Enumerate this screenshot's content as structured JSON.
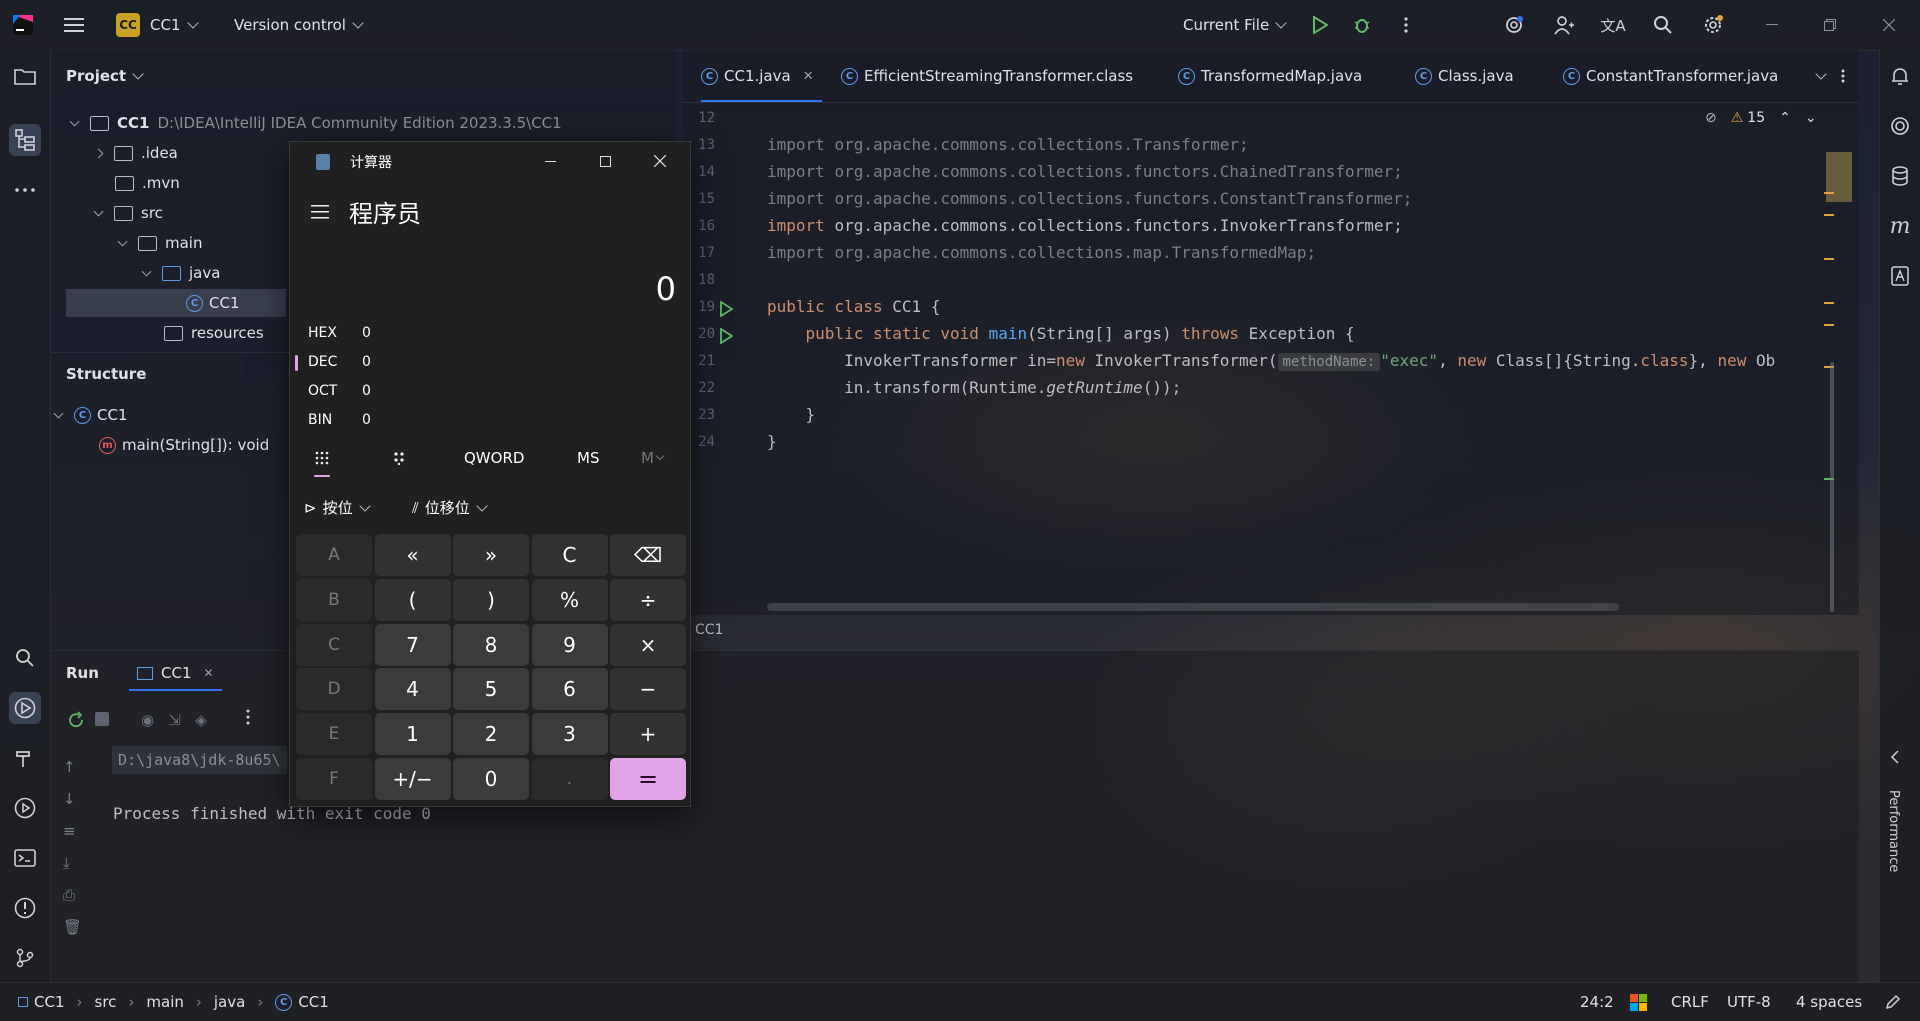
{
  "titlebar": {
    "project_badge": "CC",
    "project_name": "CC1",
    "vcs": "Version control",
    "run_config": "Current File"
  },
  "project": {
    "header": "Project",
    "root_name": "CC1",
    "root_path": "D:\\IDEA\\IntelliJ IDEA Community Edition 2023.3.5\\CC1",
    "items": [
      ".idea",
      ".mvn",
      "src",
      "main",
      "java",
      "CC1",
      "resources"
    ]
  },
  "structure": {
    "header": "Structure",
    "class_name": "CC1",
    "method": "main(String[]): void"
  },
  "editor": {
    "tabs": [
      "CC1.java",
      "EfficientStreamingTransformer.class",
      "TransformedMap.java",
      "Class.java",
      "ConstantTransformer.java"
    ],
    "warnings_count": "15",
    "line_numbers": [
      "12",
      "13",
      "14",
      "15",
      "16",
      "17",
      "18",
      "19",
      "20",
      "21",
      "22",
      "23",
      "24"
    ],
    "imports": [
      "org.apache.commons.collections.Transformer;",
      "org.apache.commons.collections.functors.ChainedTransformer;",
      "org.apache.commons.collections.functors.ConstantTransformer;",
      "org.apache.commons.collections.functors.InvokerTransformer;",
      "org.apache.commons.collections.map.TransformedMap;"
    ],
    "kw_import": "import",
    "class_decl": {
      "kw": "public class",
      "name": "CC1 {"
    },
    "main_decl": {
      "kw": "public static void",
      "name": "main",
      "params": "(String[] args)",
      "throws_kw": "throws",
      "throws_type": "Exception {"
    },
    "line21": {
      "lhs": "InvokerTransformer in=",
      "new1": "new",
      "ctor": " InvokerTransformer(",
      "hint": "methodName:",
      "arg": "\"exec\"",
      "comma": ", ",
      "new2": "new",
      "rest": " Class[]{String.",
      "cls": "class",
      "rest2": "}, ",
      "new3": "new",
      "tail": " Ob"
    },
    "line22": {
      "pre": "in.transform(Runtime.",
      "call": "getRuntime",
      "post": "());"
    },
    "close_method": "}",
    "close_class": "}",
    "breadcrumb_label": "CC1"
  },
  "run": {
    "header": "Run",
    "tab": "CC1",
    "command": "D:\\java8\\jdk-8u65\\",
    "output": "Process finished with exit code 0"
  },
  "right_panel": {
    "performance": "Performance"
  },
  "statusbar": {
    "crumbs": [
      "CC1",
      "src",
      "main",
      "java",
      "CC1"
    ],
    "position": "24:2",
    "line_sep": "CRLF",
    "encoding": "UTF-8",
    "indent": "4 spaces"
  },
  "calculator": {
    "title": "计算器",
    "mode": "程序员",
    "display": "0",
    "radix": [
      {
        "label": "HEX",
        "value": "0"
      },
      {
        "label": "DEC",
        "value": "0"
      },
      {
        "label": "OCT",
        "value": "0"
      },
      {
        "label": "BIN",
        "value": "0"
      }
    ],
    "word_size": "QWORD",
    "ms": "MS",
    "mv": "M",
    "bitwise": "按位",
    "bitshift": "位移位",
    "keys": [
      [
        "A",
        "«",
        "»",
        "C",
        "⌫"
      ],
      [
        "B",
        "(",
        ")",
        "%",
        "÷"
      ],
      [
        "C",
        "7",
        "8",
        "9",
        "×"
      ],
      [
        "D",
        "4",
        "5",
        "6",
        "−"
      ],
      [
        "E",
        "1",
        "2",
        "3",
        "+"
      ],
      [
        "F",
        "+/−",
        "0",
        ".",
        "="
      ]
    ]
  },
  "colors": {
    "accent": "#3574f0",
    "calc_equals": "#e2a3e8",
    "keyword": "#cf8e6d",
    "function": "#56a8f5",
    "string": "#6aab73"
  }
}
